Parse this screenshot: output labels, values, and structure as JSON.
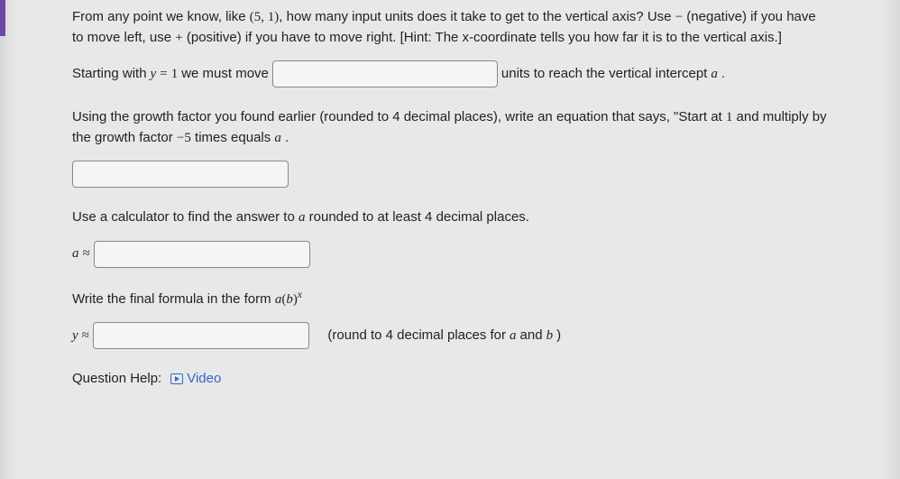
{
  "intro": {
    "line1_pre": "From any point we know, like ",
    "point_open": "(",
    "point_x": "5",
    "point_sep": ", ",
    "point_y": "1",
    "point_close": ")",
    "line1_post": ", how many input units does it take to get to the vertical axis? Use ",
    "minus": "−",
    "line2_pre": " (negative) if you have to move left, use ",
    "plus": "+",
    "line2_post": " (positive) if you have to move right. [Hint: The x-coordinate tells you how far it is to the vertical axis.]"
  },
  "q1": {
    "pre": "Starting with ",
    "y": "y",
    "eq": " = ",
    "one": "1",
    "mid": " we must move ",
    "post": " units to reach the vertical intercept ",
    "a": "a",
    "period": " ."
  },
  "q2": {
    "line1": "Using the growth factor you found earlier (rounded to 4 decimal places), write an equation that says, \"Start at ",
    "one": "1",
    "mid": " and multiply by the growth factor ",
    "neg5": "−5",
    "post": " times equals ",
    "a": "a",
    "period": " ."
  },
  "q3": {
    "text_pre": "Use a calculator to find the answer to ",
    "a": "a",
    "text_post": " rounded to at least 4 decimal places.",
    "label_a": "a",
    "approx": " ≈ "
  },
  "q4": {
    "pre": "Write the final formula in the form ",
    "a": "a",
    "lp": "(",
    "b": "b",
    "rp": ")",
    "x": "x",
    "label_y": "y",
    "approx": " ≈ ",
    "hint_pre": "(round to 4 decimal places for ",
    "hint_a": "a",
    "hint_and": " and ",
    "hint_b": "b",
    "hint_post": " )"
  },
  "help": {
    "label": "Question Help:",
    "video": "Video"
  }
}
